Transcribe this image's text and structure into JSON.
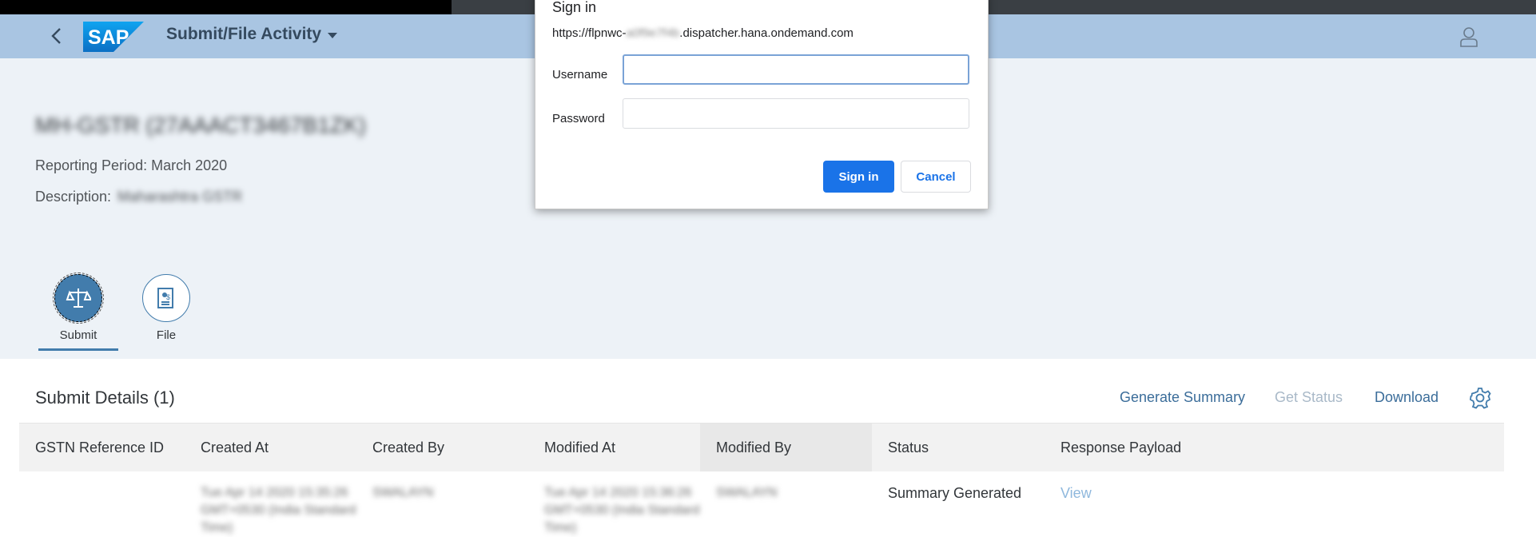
{
  "shell": {
    "app_title": "Submit/File Activity",
    "logo_text": "SAP"
  },
  "header": {
    "object_title": "MH-GSTR (27AAACT3467B1ZK)",
    "reporting_period": "Reporting Period: March 2020",
    "description_label": "Description:",
    "description_value": "Maharashtra GSTR"
  },
  "tabs": [
    {
      "label": "Submit",
      "icon": "scale-icon",
      "selected": true
    },
    {
      "label": "File",
      "icon": "document-icon",
      "selected": false
    }
  ],
  "table": {
    "title": "Submit Details (1)",
    "toolbar": {
      "generate_summary": "Generate Summary",
      "get_status": "Get Status",
      "download": "Download"
    },
    "columns": [
      "GSTN Reference ID",
      "Created At",
      "Created By",
      "Modified At",
      "Modified By",
      "Status",
      "Response Payload"
    ],
    "rows": [
      {
        "gstn_reference_id": "",
        "created_at": "Tue Apr 14 2020 15:35:26 GMT+0530 (India Standard Time)",
        "created_by": "SWALAYN",
        "modified_at": "Tue Apr 14 2020 15:36:26 GMT+0530 (India Standard Time)",
        "modified_by": "SWALAYN",
        "status": "Summary Generated",
        "response_payload": "View"
      }
    ]
  },
  "dialog": {
    "title": "Sign in",
    "url_prefix": "https://flpnwc-",
    "url_hidden": "a0f9e7f4b",
    "url_suffix": ".dispatcher.hana.ondemand.com",
    "username_label": "Username",
    "password_label": "Password",
    "username_value": "",
    "password_value": "",
    "signin_button": "Sign in",
    "cancel_button": "Cancel"
  },
  "colors": {
    "shell_bg": "#a9c5e2",
    "accent": "#427cac",
    "dialog_primary": "#1a73e8"
  }
}
